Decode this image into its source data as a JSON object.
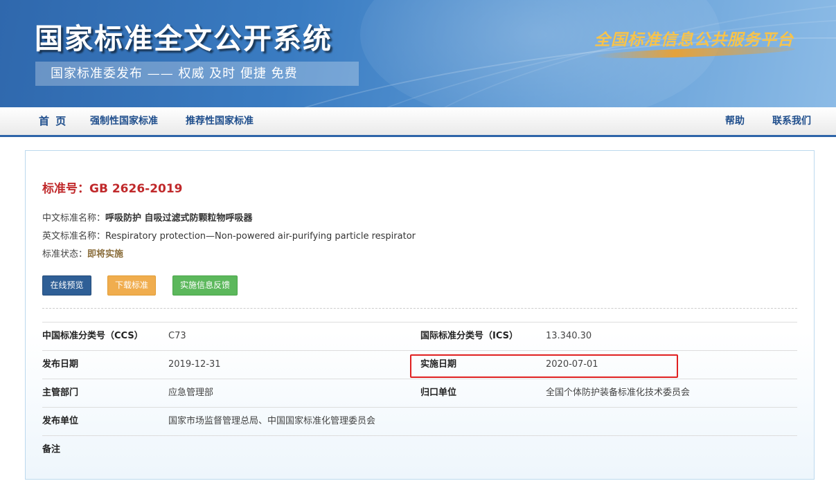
{
  "header": {
    "site_title": "国家标准全文公开系统",
    "slogan": "国家标准委发布 —— 权威 及时 便捷 免费",
    "platform_name": "全国标准信息公共服务平台"
  },
  "nav": {
    "home": "首 页",
    "mandatory": "强制性国家标准",
    "recommended": "推荐性国家标准",
    "help": "帮助",
    "contact": "联系我们"
  },
  "standard": {
    "title": "标准号：GB 2626-2019",
    "cn_name_label": "中文标准名称：",
    "cn_name": "呼吸防护 自吸过滤式防颗粒物呼吸器",
    "en_name_label": "英文标准名称：",
    "en_name": "Respiratory protection—Non-powered air-purifying particle respirator",
    "status_label": "标准状态：",
    "status": "即将实施"
  },
  "buttons": {
    "preview": "在线预览",
    "download": "下载标准",
    "feedback": "实施信息反馈"
  },
  "meta": {
    "ccs_label": "中国标准分类号（CCS）",
    "ccs": "C73",
    "ics_label": "国际标准分类号（ICS）",
    "ics": "13.340.30",
    "publish_date_label": "发布日期",
    "publish_date": "2019-12-31",
    "implement_date_label": "实施日期",
    "implement_date": "2020-07-01",
    "department_label": "主管部门",
    "department": "应急管理部",
    "tc_label": "归口单位",
    "tc": "全国个体防护装备标准化技术委员会",
    "publisher_label": "发布单位",
    "publisher": "国家市场监督管理总局、中国国家标准化管理委员会",
    "remark_label": "备注",
    "remark": ""
  },
  "colors": {
    "title_red": "#c0292b",
    "nav_blue": "#1f4e8c",
    "highlight": "#e02020"
  }
}
